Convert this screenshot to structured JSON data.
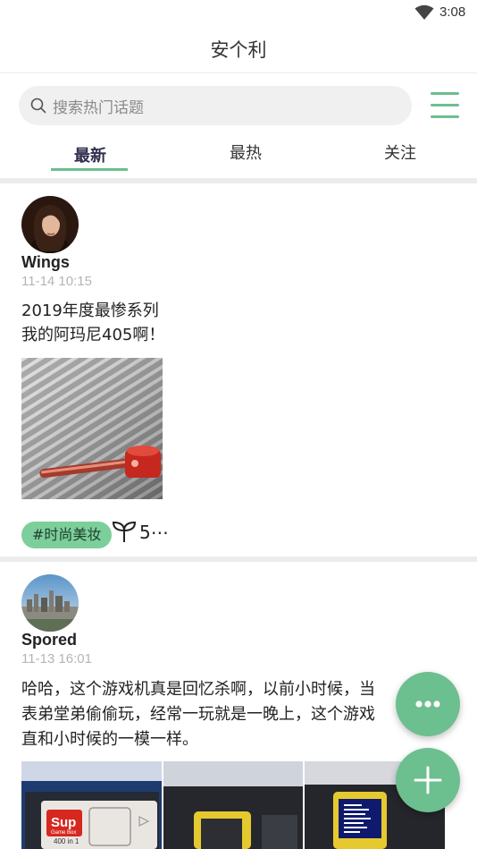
{
  "status_bar": {
    "time": "3:08"
  },
  "app": {
    "title": "安个利"
  },
  "search": {
    "placeholder": "搜索热门话题"
  },
  "tabs": [
    {
      "label": "最新",
      "active": true
    },
    {
      "label": "最热",
      "active": false
    },
    {
      "label": "关注",
      "active": false
    }
  ],
  "posts": [
    {
      "username": "Wings",
      "time": "11-14 10:15",
      "content_lines": [
        "2019年度最惨系列",
        "我的阿玛尼405啊！"
      ],
      "tag": "#时尚美妆",
      "like_count": "5⋯"
    },
    {
      "username": "Spored",
      "time": "11-13 16:01",
      "content_lines": [
        "哈哈，这个游戏机真是回忆杀啊，以前小时候，当",
        "表弟堂弟偷偷玩，经常一玩就是一晚上，这个游戏",
        "直和小时候的一模一样。"
      ],
      "image_text": {
        "brand": "Sup",
        "subtitle": "Game Box",
        "count": "400 in 1"
      }
    }
  ],
  "colors": {
    "accent": "#6cbf8e",
    "tag_bg": "#7ccf9b"
  },
  "icons": {
    "fab_more": "more-horizontal-icon",
    "fab_add": "plus-icon",
    "menu": "hamburger-menu-icon",
    "search": "search-icon",
    "like": "sprout-icon"
  }
}
